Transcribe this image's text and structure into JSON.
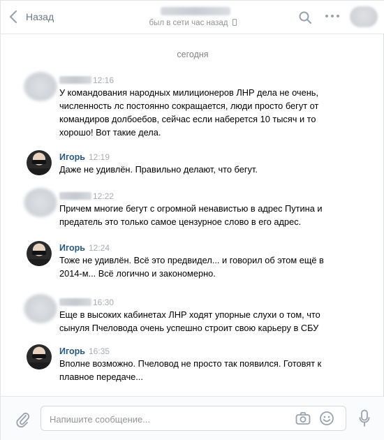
{
  "header": {
    "back_label": "Назад",
    "status": "был в сети час назад"
  },
  "history": {
    "date_separator": "сегодня",
    "messages": [
      {
        "author": "",
        "time": "12:16",
        "text": "У командования народных милиционеров ЛНР дела не очень, численность лс постоянно сокращается, люди просто бегут от командиров долбоебов, сейчас если наберется 10 тысяч и то хорошо! Вот такие дела."
      },
      {
        "author": "Игорь",
        "time": "12:19",
        "text": "Даже не удивлён. Правильно делают, что бегут."
      },
      {
        "author": "",
        "time": "12:22",
        "text": "Причем многие бегут с огромной ненавистью в адрес Путина и предатель это только самое цензурное слово в его адрес."
      },
      {
        "author": "Игорь",
        "time": "12:24",
        "text": "Тоже не удивлён. Всё это предвидел... и говорил об этом ещё в 2014-м... Всё логично и закономерно."
      },
      {
        "author": "",
        "time": "16:30",
        "text": "Еще в высоких кабинетах ЛНР ходят упорные слухи о том, что сынуля Пчеловода очень успешно строит свою карьеру в СБУ"
      },
      {
        "author": "Игорь",
        "time": "16:35",
        "text": "Вполне возможно. Пчеловод не просто так появился. Готовят к плавное передаче..."
      }
    ]
  },
  "composer": {
    "placeholder": "Напишите сообщение...",
    "value": ""
  },
  "icons": {
    "back": "chevron-left-icon",
    "search": "search-icon",
    "more": "more-dots-icon",
    "attach": "paperclip-icon",
    "camera": "camera-icon",
    "emoji": "smile-icon",
    "mic": "microphone-icon",
    "phone": "mobile-phone-icon"
  },
  "colors": {
    "link": "#2a5885",
    "secondary_text": "#909499",
    "icon": "#99a2ad"
  }
}
